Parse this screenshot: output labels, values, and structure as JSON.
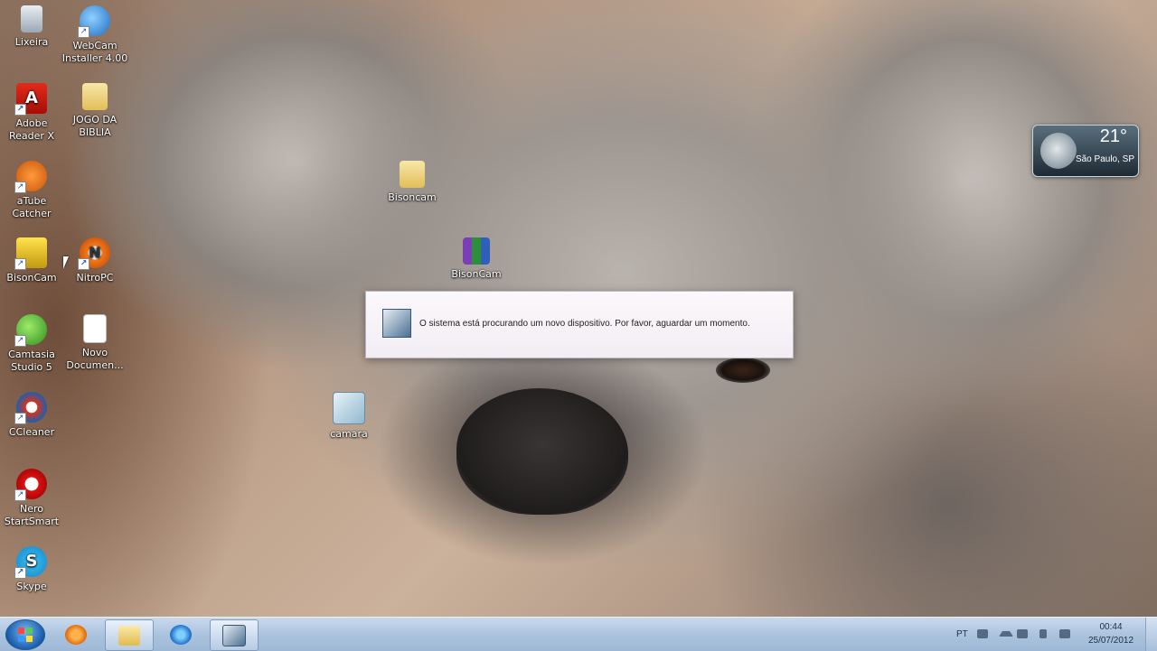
{
  "desktop": {
    "icons": [
      {
        "label": "Lixeira",
        "icon": "recycle-bin-icon"
      },
      {
        "label": "WebCam Installer 4.00",
        "icon": "webcam-installer-icon"
      },
      {
        "label": "Adobe Reader X",
        "icon": "adobe-reader-icon"
      },
      {
        "label": "JOGO DA BIBLIA",
        "icon": "folder-icon"
      },
      {
        "label": "aTube Catcher",
        "icon": "atube-catcher-icon"
      },
      {
        "label": "BisonCam",
        "icon": "bisoncam-icon"
      },
      {
        "label": "NitroPC",
        "icon": "nitropc-icon"
      },
      {
        "label": "Camtasia Studio 5",
        "icon": "camtasia-icon"
      },
      {
        "label": "Novo Documen...",
        "icon": "document-icon"
      },
      {
        "label": "CCleaner",
        "icon": "ccleaner-icon"
      },
      {
        "label": "Nero StartSmart",
        "icon": "nero-icon"
      },
      {
        "label": "Skype",
        "icon": "skype-icon"
      },
      {
        "label": "Bisoncam",
        "icon": "folder-icon"
      },
      {
        "label": "BisonCam",
        "icon": "winrar-archive-icon"
      },
      {
        "label": "camara",
        "icon": "setup-icon"
      }
    ]
  },
  "dialog": {
    "message": "O sistema está procurando um novo dispositivo. Por favor, aguardar um momento."
  },
  "weather": {
    "temperature": "21°",
    "city": "São Paulo, SP"
  },
  "taskbar": {
    "language": "PT",
    "time": "00:44",
    "date": "25/07/2012",
    "pinned": [
      "start-button",
      "media-player",
      "windows-explorer",
      "internet-explorer",
      "device-setup"
    ]
  },
  "colors": {
    "taskbar": "#a9c2de",
    "dialog_bg": "#f2edf3"
  }
}
